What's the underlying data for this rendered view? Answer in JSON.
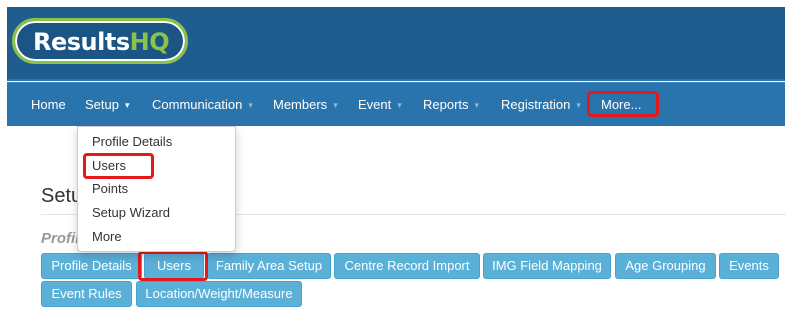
{
  "brand": {
    "logo_main": "Results",
    "logo_accent": "HQ"
  },
  "nav": {
    "items": [
      {
        "label": "Home",
        "caret": ""
      },
      {
        "label": "Setup",
        "caret": "▾"
      },
      {
        "label": "Communication",
        "caret": "▾"
      },
      {
        "label": "Members",
        "caret": "▾"
      },
      {
        "label": "Event",
        "caret": "▾"
      },
      {
        "label": "Reports",
        "caret": "▾"
      },
      {
        "label": "Registration",
        "caret": "▾"
      },
      {
        "label": "More...",
        "caret": ""
      }
    ]
  },
  "setup_menu": {
    "items": [
      {
        "label": "Profile Details"
      },
      {
        "label": "Users"
      },
      {
        "label": "Points"
      },
      {
        "label": "Setup Wizard"
      },
      {
        "label": "More"
      }
    ]
  },
  "page": {
    "title": "Setup",
    "subtitle": "Profile"
  },
  "buttons": [
    {
      "label": "Profile Details"
    },
    {
      "label": "Users"
    },
    {
      "label": "Family Area Setup"
    },
    {
      "label": "Centre Record Import"
    },
    {
      "label": "IMG Field Mapping"
    },
    {
      "label": "Age Grouping"
    },
    {
      "label": "Events"
    },
    {
      "label": "Event Rules"
    },
    {
      "label": "Location/Weight/Measure"
    }
  ],
  "colors": {
    "header_bg": "#1f5d8f",
    "navbar_bg": "#2a74ad",
    "button_bg": "#5bb0d8",
    "highlight_box": "#e3191c",
    "logo_accent": "#8bc34a"
  }
}
